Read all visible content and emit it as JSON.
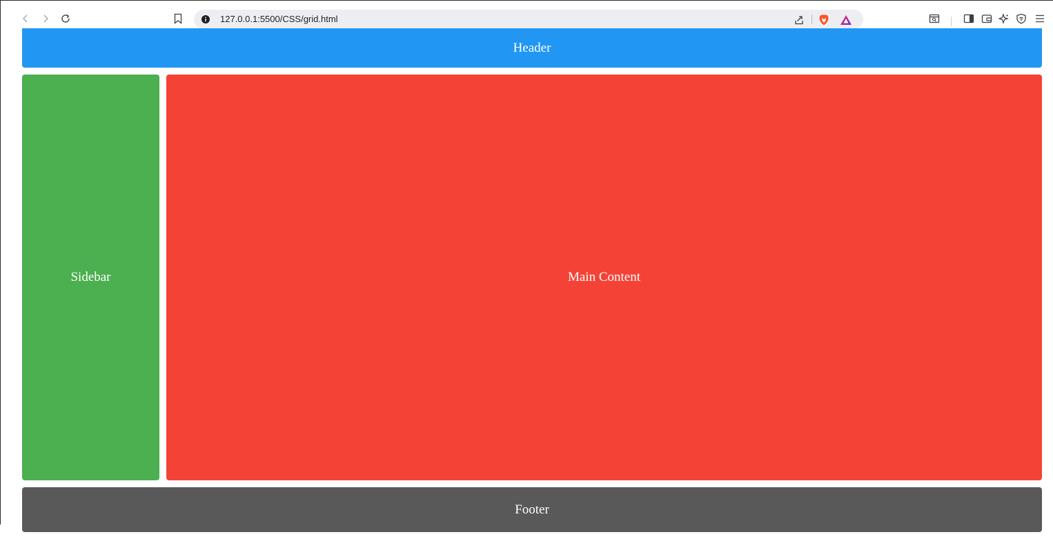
{
  "browser": {
    "url": "127.0.0.1:5500/CSS/grid.html"
  },
  "icons": {
    "back": "chevron-left-icon",
    "forward": "chevron-right-icon",
    "reload": "reload-icon",
    "bookmark": "bookmark-icon",
    "site_info": "info-icon",
    "share": "share-icon",
    "brave_shields": "brave-lion-icon",
    "brave_rewards": "rewards-triangle-icon",
    "tab_search": "tab-search-icon",
    "sidebar_toggle": "sidebar-icon",
    "wallet": "wallet-icon",
    "leo": "leo-sparkle-icon",
    "vpn": "vpn-shield-icon",
    "menu": "hamburger-menu-icon"
  },
  "colors": {
    "header": "#2196f3",
    "sidebar": "#4caf50",
    "main": "#f44336",
    "footer": "#595959"
  },
  "layout": {
    "header": "Header",
    "sidebar": "Sidebar",
    "main": "Main Content",
    "footer": "Footer"
  }
}
